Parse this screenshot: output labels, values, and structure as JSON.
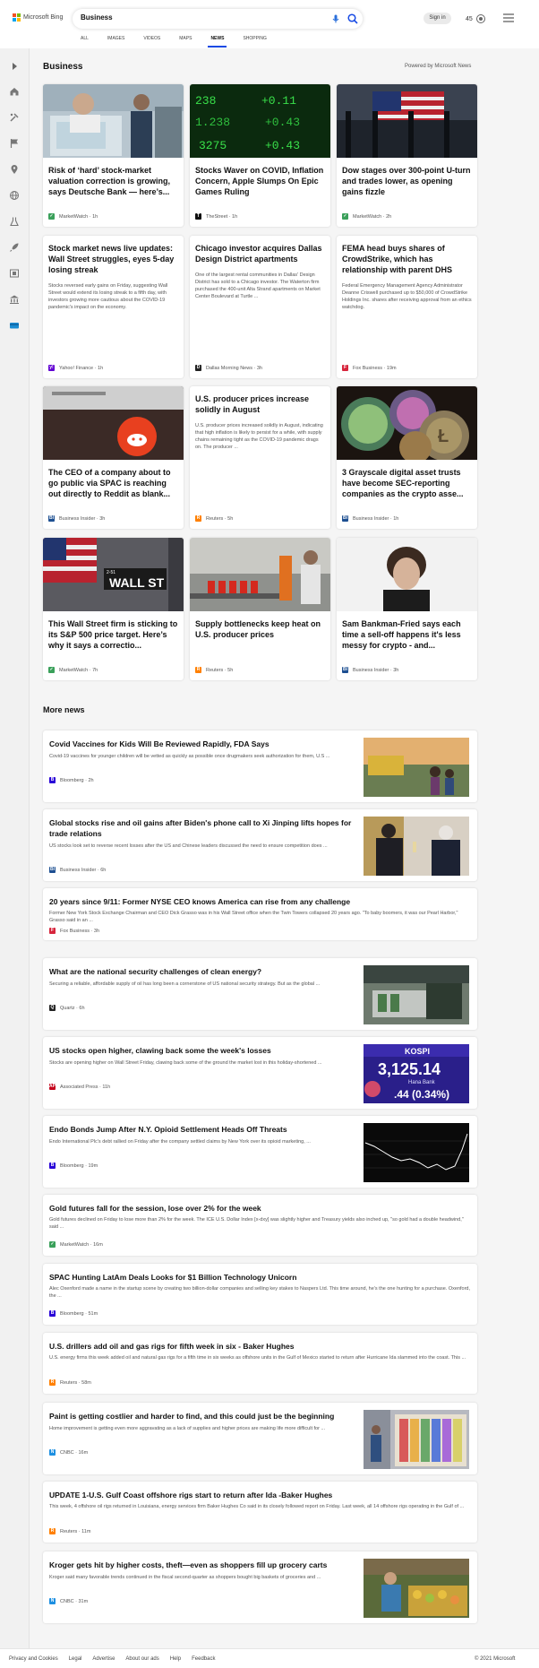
{
  "header": {
    "brand": "Microsoft Bing",
    "search_value": "Business",
    "signin": "Sign in",
    "rewards_points": "45",
    "tabs": [
      "ALL",
      "IMAGES",
      "VIDEOS",
      "MAPS",
      "NEWS",
      "SHOPPING"
    ],
    "active_tab": "NEWS"
  },
  "rail_icons": [
    "chevron-right-icon",
    "home-icon",
    "tools-icon",
    "flag-icon",
    "location-icon",
    "globe-icon",
    "science-icon",
    "rocket-icon",
    "film-icon",
    "bank-icon",
    "card-icon"
  ],
  "section": {
    "title": "Business",
    "powered_by": "Powered by Microsoft News"
  },
  "cards": [
    {
      "title": "Risk of ‘hard’ stock-market valuation correction is growing, says Deutsche Bank — here’s...",
      "source": "MarketWatch",
      "time": "1h",
      "summary": ""
    },
    {
      "title": "Stocks Waver on COVID, Inflation Concern, Apple Slumps On Epic Games Ruling",
      "source": "TheStreet",
      "time": "1h",
      "summary": ""
    },
    {
      "title": "Dow stages over 300-point U-turn and trades lower, as opening gains fizzle",
      "source": "MarketWatch",
      "time": "2h",
      "summary": ""
    },
    {
      "title": "Stock market news live updates: Wall Street struggles, eyes 5-day losing streak",
      "source": "Yahoo! Finance",
      "time": "1h",
      "summary": "Stocks reversed early gains on Friday, suggesting Wall Street would extend its losing streak to a fifth day, with investors growing more cautious about the COVID-19 pandemic's impact on the economy."
    },
    {
      "title": "Chicago investor acquires Dallas Design District apartments",
      "source": "Dallas Morning News",
      "time": "3h",
      "summary": "One of the largest rental communities in Dallas' Design District has sold to a Chicago investor. The Waterton firm purchased the 400-unit Alta Strand apartments on Market Center Boulevard at Turtle ..."
    },
    {
      "title": "FEMA head buys shares of CrowdStrike, which has relationship with parent DHS",
      "source": "Fox Business",
      "time": "19m",
      "summary": "Federal Emergency Management Agency Administrator Deanne Criswell purchased up to $50,000 of CrowdStrike Holdings Inc. shares after receiving approval from an ethics watchdog."
    },
    {
      "title": "The CEO of a company about to go public via SPAC is reaching out directly to Reddit as blank...",
      "source": "Business Insider",
      "time": "3h",
      "summary": ""
    },
    {
      "title": "U.S. producer prices increase solidly in August",
      "source": "Reuters",
      "time": "5h",
      "summary": "U.S. producer prices increased solidly in August, indicating that high inflation is likely to persist for a while, with supply chains remaining tight as the COVID-19 pandemic drags on. The producer ..."
    },
    {
      "title": "3 Grayscale digital asset trusts have become SEC-reporting companies as the crypto asse...",
      "source": "Business Insider",
      "time": "1h",
      "summary": ""
    },
    {
      "title": "This Wall Street firm is sticking to its S&P 500 price target. Here’s why it says a correctio...",
      "source": "MarketWatch",
      "time": "7h",
      "summary": ""
    },
    {
      "title": "Supply bottlenecks keep heat on U.S. producer prices",
      "source": "Reuters",
      "time": "5h",
      "summary": ""
    },
    {
      "title": "Sam Bankman-Fried says each time a sell-off happens it's less messy for crypto - and...",
      "source": "Business Insider",
      "time": "3h",
      "summary": ""
    }
  ],
  "image_texts": {
    "ticker": [
      "238",
      "+0.11",
      "1.238",
      "+0.43",
      "3275",
      "+0.43"
    ],
    "wall_st": "WALL ST",
    "wall_st_num": "2-51",
    "kospi": "KOSPI",
    "kospi_value": "3,125.14",
    "kospi_change": ".44 (0.34%)",
    "hana_bank": "Hana Bank"
  },
  "more_news_title": "More news",
  "more_news": [
    {
      "title": "Covid Vaccines for Kids Will Be Reviewed Rapidly, FDA Says",
      "summary": "Covid-19 vaccines for younger children will be vetted as quickly as possible once drugmakers seek authorization for them, U.S ...",
      "source": "Bloomberg",
      "time": "2h"
    },
    {
      "title": "Global stocks rise and oil gains after Biden's phone call to Xi Jinping lifts hopes for trade relations",
      "summary": "US stocks look set to reverse recent losses after the US and Chinese leaders discussed the need to ensure competition does ...",
      "source": "Business Insider",
      "time": "6h"
    },
    {
      "title": "20 years since 9/11: Former NYSE CEO knows America can rise from any challenge",
      "summary": "Former New York Stock Exchange Chairman and CEO Dick Grasso was in his Wall Street office when the Twin Towers collapsed 20 years ago. \"To baby boomers, it was our Pearl Harbor,\" Grasso said in an ...",
      "source": "Fox Business",
      "time": "3h"
    },
    {
      "title": "What are the national security challenges of clean energy?",
      "summary": "Securing a reliable, affordable supply of oil has long been a cornerstone of US national security strategy. But as the global ...",
      "source": "Quartz",
      "time": "6h"
    },
    {
      "title": "US stocks open higher, clawing back some the week's losses",
      "summary": "Stocks are opening higher on Wall Street Friday, clawing back some of the ground the market lost in this holiday-shortened ...",
      "source": "Associated Press",
      "time": "11h"
    },
    {
      "title": "Endo Bonds Jump After N.Y. Opioid Settlement Heads Off Threats",
      "summary": "Endo International Plc’s debt rallied on Friday after the company settled claims by New York over its opioid marketing, ...",
      "source": "Bloomberg",
      "time": "19m"
    },
    {
      "title": "Gold futures fall for the session, lose over 2% for the week",
      "summary": "Gold futures declined on Friday to lose more than 2% for the week. The ICE U.S. Dollar Index [x-dxy] was slightly higher and Treasury yields also inched up, \"so gold had a double headwind,\" said ...",
      "source": "MarketWatch",
      "time": "16m"
    },
    {
      "title": "SPAC Hunting LatAm Deals Looks for $1 Billion Technology Unicorn",
      "summary": "Alec Oxenford made a name in the startup scene by creating two billion-dollar companies and selling key stakes to Naspers Ltd. This time around, he’s the one hunting for a purchase. Oxenford, the ...",
      "source": "Bloomberg",
      "time": "51m"
    },
    {
      "title": "U.S. drillers add oil and gas rigs for fifth week in six - Baker Hughes",
      "summary": "U.S. energy firms this week added oil and natural gas rigs for a fifth time in six weeks as offshore units in the Gulf of Mexico started to return after Hurricane Ida slammed into the coast. This ...",
      "source": "Reuters",
      "time": "58m"
    },
    {
      "title": "Paint is getting costlier and harder to find, and this could just be the beginning",
      "summary": "Home improvement is getting even more aggravating as a lack of supplies and higher prices are making life more difficult for ...",
      "source": "CNBC",
      "time": "16m"
    },
    {
      "title": "UPDATE 1-U.S. Gulf Coast offshore rigs start to return after Ida -Baker Hughes",
      "summary": "This week, 4 offshore oil rigs returned in Louisiana, energy services firm Baker Hughes Co said in its closely followed report on Friday. Last week, all 14 offshore rigs operating in the Gulf of ...",
      "source": "Reuters",
      "time": "11m"
    },
    {
      "title": "Kroger gets hit by higher costs, theft—even as shoppers fill up grocery carts",
      "summary": "Kroger said many favorable trends continued in the fiscal second-quarter as shoppers bought big baskets of groceries and ...",
      "source": "CNBC",
      "time": "31m"
    }
  ],
  "footer": {
    "links": [
      "Privacy and Cookies",
      "Legal",
      "Advertise",
      "About our ads",
      "Help",
      "Feedback"
    ],
    "copyright": "© 2021 Microsoft"
  },
  "colors": {
    "accent": "#174ae4",
    "marketwatch": "#3aa05a",
    "yahoo": "#6001d2",
    "bloomberg": "#2800d7",
    "reuters": "#ff8000",
    "fox": "#d7263d",
    "cnbc": "#1d8fe1",
    "quartz": "#222222"
  }
}
